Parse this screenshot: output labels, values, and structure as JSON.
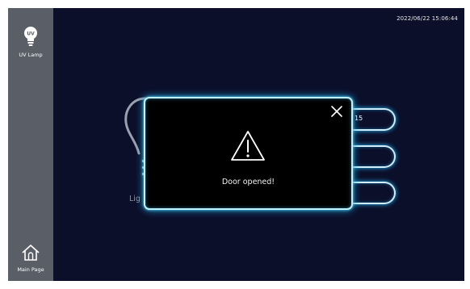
{
  "clock": "2022/06/22 15:06:44",
  "sidebar": {
    "uv_lamp": {
      "label": "UV Lamp",
      "icon": "uv-lamp-icon"
    },
    "main_page": {
      "label": "Main Page",
      "icon": "home-icon"
    }
  },
  "background": {
    "partial_label": "Lig",
    "field_values": [
      "15",
      "",
      ""
    ]
  },
  "dialog": {
    "icon": "warning-icon",
    "message": "Door opened!"
  },
  "colors": {
    "screen_bg": "#0b0f2a",
    "sidebar_bg": "#5a5e66",
    "glow": "#1fa8e0",
    "dialog_bg": "#000000"
  }
}
